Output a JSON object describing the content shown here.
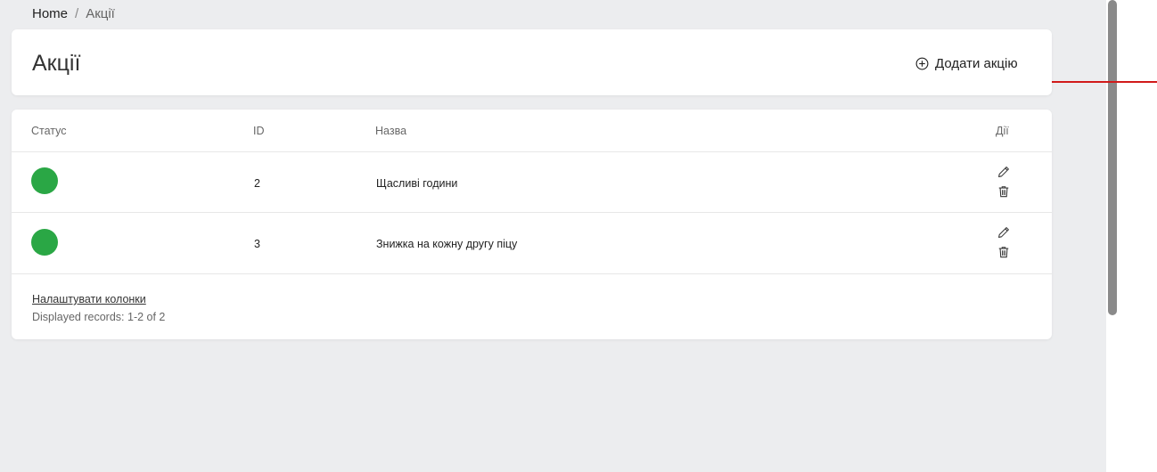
{
  "breadcrumb": {
    "home": "Home",
    "separator": "/",
    "current": "Акції"
  },
  "header": {
    "title": "Акції",
    "add_button_label": "Додати акцію",
    "add_button_icon": "plus-circle-icon"
  },
  "table": {
    "columns": {
      "status": "Статус",
      "id": "ID",
      "name": "Назва",
      "actions": "Дії"
    },
    "rows": [
      {
        "status": "active",
        "status_color": "#2aa745",
        "id": "2",
        "name": "Щасливі години"
      },
      {
        "status": "active",
        "status_color": "#2aa745",
        "id": "3",
        "name": "Знижка на кожну другу піцу"
      }
    ],
    "row_action_icons": [
      "pencil-icon",
      "trash-icon"
    ]
  },
  "footer": {
    "configure_columns_label": "Налаштувати колонки",
    "records_info": "Displayed records: 1-2 of 2"
  },
  "colors": {
    "background": "#ecedef",
    "card": "#ffffff",
    "status_active": "#2aa745",
    "annotation_line": "#d11a1a"
  }
}
